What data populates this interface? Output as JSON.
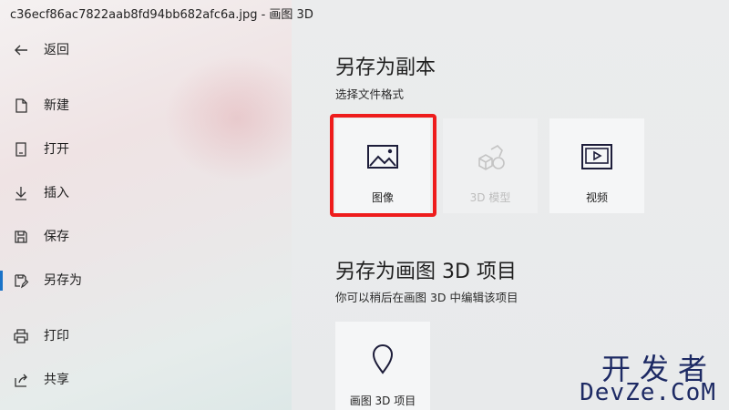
{
  "window": {
    "title": "c36ecf86ac7822aab8fd94bb682afc6a.jpg - 画图 3D"
  },
  "sidebar": {
    "items": [
      {
        "label": "返回",
        "icon": "back-arrow-icon"
      },
      {
        "label": "新建",
        "icon": "new-file-icon"
      },
      {
        "label": "打开",
        "icon": "open-file-icon"
      },
      {
        "label": "插入",
        "icon": "insert-download-icon"
      },
      {
        "label": "保存",
        "icon": "save-disk-icon"
      },
      {
        "label": "另存为",
        "icon": "save-as-icon",
        "active": true
      },
      {
        "label": "打印",
        "icon": "printer-icon"
      },
      {
        "label": "共享",
        "icon": "share-icon"
      }
    ],
    "accent": "#1a73c8"
  },
  "main": {
    "save_copy": {
      "title": "另存为副本",
      "subtitle": "选择文件格式",
      "options": [
        {
          "label": "图像",
          "icon": "image-icon",
          "selected": true
        },
        {
          "label": "3D 模型",
          "icon": "3d-shapes-icon",
          "disabled": true
        },
        {
          "label": "视频",
          "icon": "video-icon"
        }
      ]
    },
    "save_project": {
      "title": "另存为画图 3D 项目",
      "subtitle": "你可以稍后在画图 3D 中编辑该项目",
      "options": [
        {
          "label": "画图 3D 项目",
          "icon": "paint3d-project-icon"
        }
      ]
    },
    "highlight_color": "#ee1c1c"
  },
  "watermark": {
    "line1": "开发者",
    "line2": "DevZe.CoM"
  }
}
